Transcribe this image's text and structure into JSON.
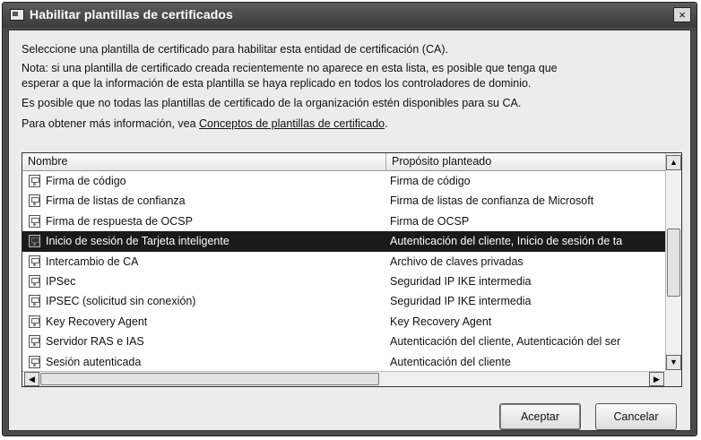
{
  "window": {
    "title": "Habilitar plantillas de certificados",
    "close_label": "×"
  },
  "intro": {
    "line1": "Seleccione una plantilla de certificado para habilitar esta entidad de certificación (CA).",
    "line2a": "Nota: si una plantilla de certificado creada recientemente no aparece en esta lista, es posible que tenga que",
    "line2b": "esperar a que la información de esta plantilla se haya replicado en todos los controladores de dominio.",
    "line3": "Es posible que no todas las plantillas de certificado de la organización estén disponibles para su CA.",
    "line4_prefix": "Para obtener más información, vea ",
    "line4_link": "Conceptos de plantillas de certificado",
    "line4_suffix": "."
  },
  "list": {
    "headers": {
      "name": "Nombre",
      "purpose": "Propósito planteado"
    },
    "rows": [
      {
        "name": "Firma de código",
        "purpose": "Firma de código"
      },
      {
        "name": "Firma de listas de confianza",
        "purpose": "Firma de listas de confianza de Microsoft"
      },
      {
        "name": "Firma de respuesta de OCSP",
        "purpose": "Firma de OCSP"
      },
      {
        "name": "Inicio de sesión de Tarjeta inteligente",
        "purpose": "Autenticación del cliente, Inicio de sesión de ta",
        "selected": true
      },
      {
        "name": "Intercambio de CA",
        "purpose": "Archivo de claves privadas"
      },
      {
        "name": "IPSec",
        "purpose": "Seguridad IP IKE intermedia"
      },
      {
        "name": "IPSEC (solicitud sin conexión)",
        "purpose": "Seguridad IP IKE intermedia"
      },
      {
        "name": "Key Recovery Agent",
        "purpose": "Key Recovery Agent"
      },
      {
        "name": "Servidor RAS e IAS",
        "purpose": "Autenticación del cliente, Autenticación del ser"
      },
      {
        "name": "Sesión autenticada",
        "purpose": "Autenticación del cliente"
      }
    ]
  },
  "buttons": {
    "accept": "Aceptar",
    "cancel": "Cancelar"
  },
  "icons": {
    "title": "window-app-icon",
    "row": "certificate-template-icon",
    "scroll_up": "▲",
    "scroll_down": "▼",
    "scroll_left": "◀",
    "scroll_right": "▶"
  }
}
